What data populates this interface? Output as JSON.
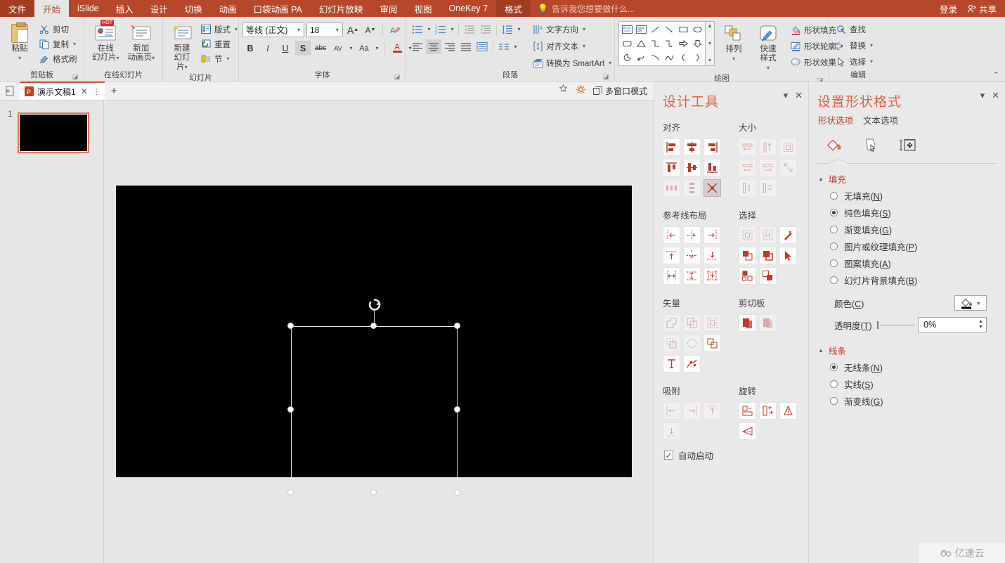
{
  "titlebar": {
    "tabs": [
      {
        "label": "文件",
        "state": "file"
      },
      {
        "label": "开始",
        "state": "active-white"
      },
      {
        "label": "iSlide",
        "state": "normal"
      },
      {
        "label": "插入",
        "state": "normal"
      },
      {
        "label": "设计",
        "state": "normal"
      },
      {
        "label": "切换",
        "state": "normal"
      },
      {
        "label": "动画",
        "state": "normal"
      },
      {
        "label": "口袋动画 PA",
        "state": "normal"
      },
      {
        "label": "幻灯片放映",
        "state": "normal"
      },
      {
        "label": "审阅",
        "state": "normal"
      },
      {
        "label": "视图",
        "state": "normal"
      },
      {
        "label": "OneKey 7",
        "state": "normal"
      },
      {
        "label": "格式",
        "state": "active-dark"
      }
    ],
    "tell_me": "告诉我您想要做什么...",
    "sign_in": "登录",
    "share": "共享",
    "accent": "#b7472a"
  },
  "ribbon": {
    "groups": [
      {
        "name": "剪贴板",
        "has_launcher": true,
        "paste": {
          "label_line1": "粘贴",
          "caret": "▾"
        },
        "items": [
          {
            "label": "剪切",
            "icon": "scissors-icon"
          },
          {
            "label": "复制",
            "icon": "copy-icon",
            "caret": "▾"
          },
          {
            "label": "格式刷",
            "icon": "format-painter-icon"
          }
        ]
      },
      {
        "name": "在线幻灯片",
        "has_launcher": false,
        "buttons": [
          {
            "line1": "在线",
            "line2": "幻灯片",
            "caret": "▾",
            "badge": "HOT"
          },
          {
            "line1": "新加",
            "line2": "动画页",
            "caret": "▾"
          }
        ]
      },
      {
        "name": "幻灯片",
        "has_launcher": false,
        "buttons": [
          {
            "line1": "新建",
            "line2": "幻灯片",
            "caret": "▾"
          }
        ],
        "items": [
          {
            "label": "版式",
            "caret": "▾"
          },
          {
            "label": "重置"
          },
          {
            "label": "节",
            "caret": "▾"
          }
        ]
      },
      {
        "name": "字体",
        "has_launcher": true,
        "font_name": "等线 (正文)",
        "font_size": "18",
        "grow_label": "A",
        "shrink_label": "A",
        "clear_label": "✦",
        "toggles": [
          "B",
          "I",
          "U",
          "S",
          "abc",
          "AV",
          "Aa",
          "A"
        ]
      },
      {
        "name": "段落",
        "has_launcher": true,
        "items": [
          {
            "label": "文字方向",
            "caret": "▾"
          },
          {
            "label": "对齐文本",
            "caret": "▾"
          },
          {
            "label": "转换为 SmartArt",
            "caret": "▾"
          }
        ]
      },
      {
        "name": "绘图",
        "has_launcher": true,
        "buttons": [
          {
            "line1": "排列",
            "caret": "▾"
          },
          {
            "line1": "快速样式",
            "caret": "▾"
          }
        ],
        "items": [
          {
            "label": "形状填充",
            "caret": "▾"
          },
          {
            "label": "形状轮廓",
            "caret": "▾"
          },
          {
            "label": "形状效果",
            "caret": "▾"
          }
        ]
      },
      {
        "name": "编辑",
        "has_launcher": false,
        "items": [
          {
            "label": "查找",
            "icon": "search-icon"
          },
          {
            "label": "替换",
            "icon": "replace-icon",
            "caret": "▾"
          },
          {
            "label": "选择",
            "icon": "select-icon",
            "caret": "▾"
          }
        ]
      }
    ],
    "collapse_caret": "⌃"
  },
  "docbar": {
    "tab_title": "演示文稿1",
    "close": "✕",
    "menu_dots": "⋮",
    "new_tab": "+",
    "multi_window": "多窗口模式"
  },
  "thumbnails": {
    "slides": [
      {
        "number": "1"
      }
    ]
  },
  "design_tools": {
    "title": "设计工具",
    "collapse": "▾",
    "close": "✕",
    "sections": [
      {
        "heading": "对齐",
        "rows": 3,
        "cols": 3,
        "selected_index": 8
      },
      {
        "heading": "大小",
        "rows": 3,
        "cols": 3,
        "dimmed": true
      },
      {
        "heading": "参考线布局",
        "rows": 3,
        "cols": 3
      },
      {
        "heading": "选择",
        "rows": 3,
        "cols": 3
      },
      {
        "heading": "矢量",
        "rows": 3,
        "cols": 3
      },
      {
        "heading": "剪切板",
        "rows": 1,
        "cols": 2
      },
      {
        "heading": "吸附",
        "rows": 2,
        "cols": 2
      },
      {
        "heading": "旋转",
        "rows": 2,
        "cols": 2
      }
    ],
    "auto_start": {
      "label": "自动启动",
      "checked": true,
      "mark": "✓"
    }
  },
  "format_shape": {
    "title": "设置形状格式",
    "collapse": "▾",
    "close": "✕",
    "subtabs": [
      {
        "label": "形状选项",
        "active": true
      },
      {
        "label": "文本选项",
        "active": false
      }
    ],
    "icon_tabs": [
      {
        "name": "fill-bucket-icon",
        "active": true
      },
      {
        "name": "effects-pentagon-icon",
        "active": false
      },
      {
        "name": "size-layout-icon",
        "active": false
      }
    ],
    "fill": {
      "heading": "填充",
      "tri": "▲",
      "options": [
        {
          "label": "无填充(",
          "key": "N",
          "suffix": ")",
          "checked": false
        },
        {
          "label": "纯色填充(",
          "key": "S",
          "suffix": ")",
          "checked": true
        },
        {
          "label": "渐变填充(",
          "key": "G",
          "suffix": ")",
          "checked": false
        },
        {
          "label": "图片或纹理填充(",
          "key": "P",
          "suffix": ")",
          "checked": false
        },
        {
          "label": "图案填充(",
          "key": "A",
          "suffix": ")",
          "checked": false
        },
        {
          "label": "幻灯片背景填充(",
          "key": "B",
          "suffix": ")",
          "checked": false
        }
      ],
      "color": {
        "label": "颜色(",
        "key": "C",
        "suffix": ")",
        "swatch": "#000000",
        "caret": "▾"
      },
      "transparency": {
        "label": "透明度(",
        "key": "T",
        "suffix": ")",
        "value": "0%"
      }
    },
    "line": {
      "heading": "线条",
      "tri": "▲",
      "options": [
        {
          "label": "无线条(",
          "key": "N",
          "suffix": ")",
          "checked": true
        },
        {
          "label": "实线(",
          "key": "S",
          "suffix": ")",
          "checked": false
        },
        {
          "label": "渐变线(",
          "key": "G",
          "suffix": ")",
          "checked": false
        }
      ]
    }
  },
  "watermark": {
    "text": "亿速云"
  }
}
